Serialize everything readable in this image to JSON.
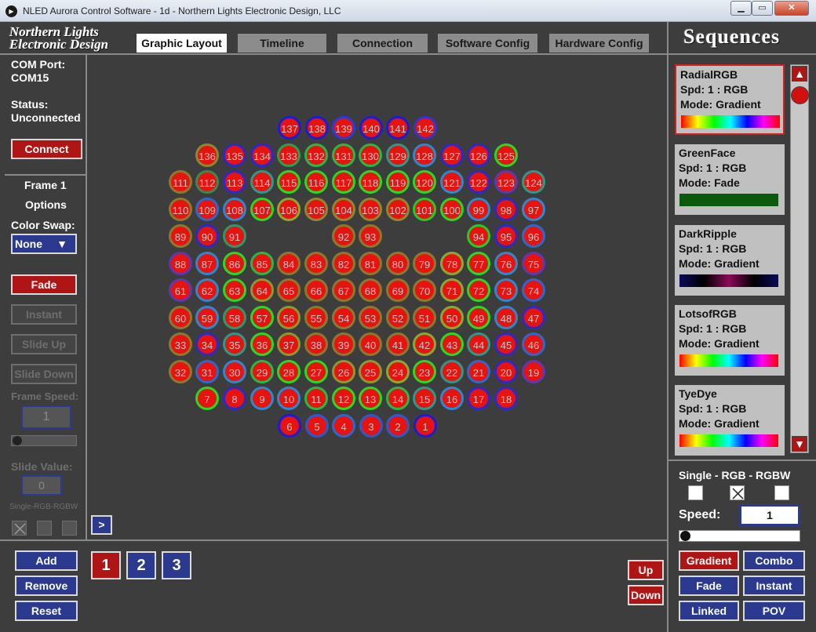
{
  "window": {
    "title": "NLED Aurora Control Software - 1d - Northern Lights Electronic Design, LLC"
  },
  "logo": {
    "line1": "Northern Lights",
    "line2": "Electronic Design"
  },
  "tabs": [
    "Graphic Layout",
    "Timeline",
    "Connection",
    "Software Config",
    "Hardware Config"
  ],
  "left": {
    "com_label": "COM Port:",
    "com_value": "COM15",
    "status_label": "Status:",
    "status_value": "Unconnected",
    "connect": "Connect",
    "frame": "Frame 1",
    "options": "Options",
    "color_swap": "Color Swap:",
    "swap_value": "None",
    "fade": "Fade",
    "instant": "Instant",
    "slide_up": "Slide Up",
    "slide_down": "Slide Down",
    "frame_speed": "Frame Speed:",
    "frame_speed_value": "1",
    "slide_value": "Slide Value:",
    "slide_value_value": "0",
    "mode_label": "Single-RGB-RGBW"
  },
  "canvas": {
    "expand": ">"
  },
  "nodes": [
    {
      "n": "137",
      "c": "#1b1bd9"
    },
    {
      "n": "138",
      "c": "#1b1bd9"
    },
    {
      "n": "139",
      "c": "#2a3ae0"
    },
    {
      "n": "140",
      "c": "#1b1bd9"
    },
    {
      "n": "141",
      "c": "#1b1bd9"
    },
    {
      "n": "142",
      "c": "#3b30d0"
    },
    {
      "n": "136",
      "c": "#8a8a30"
    },
    {
      "n": "135",
      "c": "#2a2acc"
    },
    {
      "n": "134",
      "c": "#2a2acc"
    },
    {
      "n": "133",
      "c": "#2aa050"
    },
    {
      "n": "132",
      "c": "#22bb44"
    },
    {
      "n": "131",
      "c": "#22bb44"
    },
    {
      "n": "130",
      "c": "#22bb44"
    },
    {
      "n": "129",
      "c": "#2a9a8a"
    },
    {
      "n": "128",
      "c": "#2a8ad0"
    },
    {
      "n": "127",
      "c": "#2a2acc"
    },
    {
      "n": "126",
      "c": "#2a2acc"
    },
    {
      "n": "125",
      "c": "#22dd22"
    },
    {
      "n": "111",
      "c": "#8a7a30"
    },
    {
      "n": "112",
      "c": "#3a8a50"
    },
    {
      "n": "113",
      "c": "#2a2acc"
    },
    {
      "n": "114",
      "c": "#2a9a8a"
    },
    {
      "n": "115",
      "c": "#22dd22"
    },
    {
      "n": "116",
      "c": "#22dd22"
    },
    {
      "n": "117",
      "c": "#22dd22"
    },
    {
      "n": "118",
      "c": "#22dd22"
    },
    {
      "n": "119",
      "c": "#22dd22"
    },
    {
      "n": "120",
      "c": "#22dd22"
    },
    {
      "n": "121",
      "c": "#2a8ad0"
    },
    {
      "n": "122",
      "c": "#2a2acc"
    },
    {
      "n": "123",
      "c": "#5a3ab0"
    },
    {
      "n": "124",
      "c": "#2a9a8a"
    },
    {
      "n": "110",
      "c": "#8a7a30"
    },
    {
      "n": "109",
      "c": "#2a6ad0"
    },
    {
      "n": "108",
      "c": "#2a8ad0"
    },
    {
      "n": "107",
      "c": "#22dd22"
    },
    {
      "n": "106",
      "c": "#88aa30"
    },
    {
      "n": "105",
      "c": "#8a8a30"
    },
    {
      "n": "104",
      "c": "#8a8a30"
    },
    {
      "n": "103",
      "c": "#8a8a30"
    },
    {
      "n": "102",
      "c": "#8a8a30"
    },
    {
      "n": "101",
      "c": "#22cc22"
    },
    {
      "n": "100",
      "c": "#22dd22"
    },
    {
      "n": "99",
      "c": "#2a8ad0"
    },
    {
      "n": "98",
      "c": "#2a2acc"
    },
    {
      "n": "97",
      "c": "#2a8ad0"
    },
    {
      "n": "89",
      "c": "#8a7a30"
    },
    {
      "n": "90",
      "c": "#2a2acc"
    },
    {
      "n": "91",
      "c": "#2a9a6a"
    },
    {
      "n": "92",
      "c": "#8a7a30"
    },
    {
      "n": "93",
      "c": "#8a7a30"
    },
    {
      "n": "94",
      "c": "#22cc22"
    },
    {
      "n": "95",
      "c": "#2a2acc"
    },
    {
      "n": "96",
      "c": "#2a6ad0"
    },
    {
      "n": "88",
      "c": "#5a3ab0"
    },
    {
      "n": "87",
      "c": "#2a8ad0"
    },
    {
      "n": "86",
      "c": "#22dd22"
    },
    {
      "n": "85",
      "c": "#22bb44"
    },
    {
      "n": "84",
      "c": "#8a7a30"
    },
    {
      "n": "83",
      "c": "#8a7a30"
    },
    {
      "n": "82",
      "c": "#8a7a30"
    },
    {
      "n": "81",
      "c": "#8a7a30"
    },
    {
      "n": "80",
      "c": "#8a7a30"
    },
    {
      "n": "79",
      "c": "#8a7a30"
    },
    {
      "n": "78",
      "c": "#88aa30"
    },
    {
      "n": "77",
      "c": "#22dd22"
    },
    {
      "n": "76",
      "c": "#2a8ad0"
    },
    {
      "n": "75",
      "c": "#5a3ab0"
    },
    {
      "n": "61",
      "c": "#5a3ab0"
    },
    {
      "n": "62",
      "c": "#2a8ad0"
    },
    {
      "n": "63",
      "c": "#22dd22"
    },
    {
      "n": "64",
      "c": "#8a9a30"
    },
    {
      "n": "65",
      "c": "#8a7a30"
    },
    {
      "n": "66",
      "c": "#8a7a30"
    },
    {
      "n": "67",
      "c": "#8a7a30"
    },
    {
      "n": "68",
      "c": "#8a7a30"
    },
    {
      "n": "69",
      "c": "#8a7a30"
    },
    {
      "n": "70",
      "c": "#8a7a30"
    },
    {
      "n": "71",
      "c": "#88aa30"
    },
    {
      "n": "72",
      "c": "#22dd22"
    },
    {
      "n": "73",
      "c": "#2a8ad0"
    },
    {
      "n": "74",
      "c": "#2a6ad0"
    },
    {
      "n": "60",
      "c": "#8a7a30"
    },
    {
      "n": "59",
      "c": "#2a8ad0"
    },
    {
      "n": "58",
      "c": "#2a9a6a"
    },
    {
      "n": "57",
      "c": "#22dd22"
    },
    {
      "n": "56",
      "c": "#8a9a30"
    },
    {
      "n": "55",
      "c": "#8a7a30"
    },
    {
      "n": "54",
      "c": "#8a7a30"
    },
    {
      "n": "53",
      "c": "#8a7a30"
    },
    {
      "n": "52",
      "c": "#8a7a30"
    },
    {
      "n": "51",
      "c": "#8a7a30"
    },
    {
      "n": "50",
      "c": "#88aa30"
    },
    {
      "n": "49",
      "c": "#22dd22"
    },
    {
      "n": "48",
      "c": "#2a8ad0"
    },
    {
      "n": "47",
      "c": "#2a2acc"
    },
    {
      "n": "33",
      "c": "#8a7a30"
    },
    {
      "n": "34",
      "c": "#2a2acc"
    },
    {
      "n": "35",
      "c": "#2a9a8a"
    },
    {
      "n": "36",
      "c": "#22dd22"
    },
    {
      "n": "37",
      "c": "#8a9a30"
    },
    {
      "n": "38",
      "c": "#8a7a30"
    },
    {
      "n": "39",
      "c": "#8a7a30"
    },
    {
      "n": "40",
      "c": "#8a7a30"
    },
    {
      "n": "41",
      "c": "#8a7a30"
    },
    {
      "n": "42",
      "c": "#88aa30"
    },
    {
      "n": "43",
      "c": "#22dd22"
    },
    {
      "n": "44",
      "c": "#2a9a8a"
    },
    {
      "n": "45",
      "c": "#2a2acc"
    },
    {
      "n": "46",
      "c": "#2a6ad0"
    },
    {
      "n": "32",
      "c": "#8a7a30"
    },
    {
      "n": "31",
      "c": "#2a6ad0"
    },
    {
      "n": "30",
      "c": "#2a8ad0"
    },
    {
      "n": "29",
      "c": "#22bb44"
    },
    {
      "n": "28",
      "c": "#22dd22"
    },
    {
      "n": "27",
      "c": "#22dd22"
    },
    {
      "n": "26",
      "c": "#8a9a30"
    },
    {
      "n": "25",
      "c": "#8a9a30"
    },
    {
      "n": "24",
      "c": "#88aa30"
    },
    {
      "n": "23",
      "c": "#22dd22"
    },
    {
      "n": "22",
      "c": "#2a9a8a"
    },
    {
      "n": "21",
      "c": "#2a6ad0"
    },
    {
      "n": "20",
      "c": "#2a2acc"
    },
    {
      "n": "19",
      "c": "#5a3ab0"
    },
    {
      "n": "7",
      "c": "#22dd22"
    },
    {
      "n": "8",
      "c": "#2a2acc"
    },
    {
      "n": "9",
      "c": "#2a8ad0"
    },
    {
      "n": "10",
      "c": "#2a8ad0"
    },
    {
      "n": "11",
      "c": "#22bb44"
    },
    {
      "n": "12",
      "c": "#22dd22"
    },
    {
      "n": "13",
      "c": "#22dd22"
    },
    {
      "n": "14",
      "c": "#22bb44"
    },
    {
      "n": "15",
      "c": "#2a9a8a"
    },
    {
      "n": "16",
      "c": "#2a8ad0"
    },
    {
      "n": "17",
      "c": "#2a2acc"
    },
    {
      "n": "18",
      "c": "#2a2acc"
    },
    {
      "n": "6",
      "c": "#1b1bd9"
    },
    {
      "n": "5",
      "c": "#2a5ad0"
    },
    {
      "n": "4",
      "c": "#2a6ad0"
    },
    {
      "n": "3",
      "c": "#2a5ad0"
    },
    {
      "n": "2",
      "c": "#2a5ad0"
    },
    {
      "n": "1",
      "c": "#1b1bd9"
    }
  ],
  "bottom": {
    "add": "Add",
    "remove": "Remove",
    "reset": "Reset",
    "frames": [
      "1",
      "2",
      "3"
    ],
    "up": "Up",
    "down": "Down"
  },
  "sequences": {
    "header": "Sequences",
    "items": [
      {
        "name": "RadialRGB",
        "spd": "Spd: 1 : RGB",
        "mode": "Mode: Gradient",
        "bar": "rainbow"
      },
      {
        "name": "GreenFace",
        "spd": "Spd: 1 : RGB",
        "mode": "Mode: Fade",
        "bar": "green"
      },
      {
        "name": "DarkRipple",
        "spd": "Spd: 1 : RGB",
        "mode": "Mode: Gradient",
        "bar": "dark"
      },
      {
        "name": "LotsofRGB",
        "spd": "Spd: 1 : RGB",
        "mode": "Mode: Gradient",
        "bar": "rainbow"
      },
      {
        "name": "TyeDye",
        "spd": "Spd: 1 : RGB",
        "mode": "Mode: Gradient",
        "bar": "rainbow"
      }
    ],
    "type_label": "Single - RGB - RGBW",
    "speed_label": "Speed:",
    "speed_value": "1",
    "modes": [
      "Gradient",
      "Combo",
      "Fade",
      "Instant",
      "Linked",
      "POV"
    ]
  },
  "colors": {
    "accent_red": "#b01515",
    "accent_blue": "#2b3a8e",
    "node_fill": "#e8130f",
    "bg": "#3d3d3d"
  }
}
